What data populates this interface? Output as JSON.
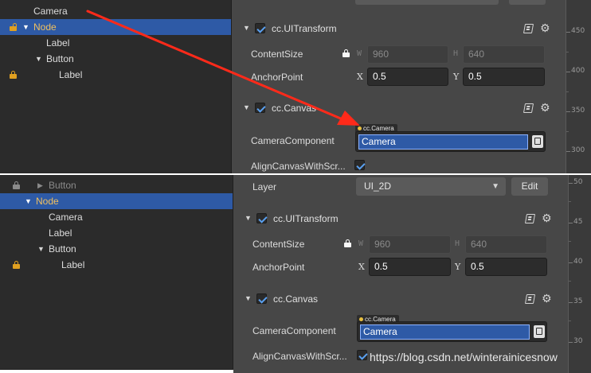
{
  "top": {
    "hierarchy": {
      "items": [
        {
          "label": "Camera"
        },
        {
          "label": "Node"
        },
        {
          "label": "Label"
        },
        {
          "label": "Button"
        },
        {
          "label": "Label"
        }
      ]
    },
    "inspector": {
      "uitransform": {
        "title": "cc.UITransform",
        "content_size_label": "ContentSize",
        "width_axis": "W",
        "width_value": "960",
        "height_axis": "H",
        "height_value": "640",
        "anchor_label": "AnchorPoint",
        "anchor_x_axis": "X",
        "anchor_x_value": "0.5",
        "anchor_y_axis": "Y",
        "anchor_y_value": "0.5"
      },
      "canvas": {
        "title": "cc.Canvas",
        "camera_label": "CameraComponent",
        "camera_tag": "cc.Camera",
        "camera_value": "Camera",
        "align_label": "AlignCanvasWithScr..."
      }
    },
    "ruler": [
      "450",
      "400",
      "350",
      "300"
    ]
  },
  "bottom": {
    "hierarchy": {
      "items": [
        {
          "label": "Button"
        },
        {
          "label": "Node"
        },
        {
          "label": "Camera"
        },
        {
          "label": "Label"
        },
        {
          "label": "Button"
        },
        {
          "label": "Label"
        }
      ]
    },
    "inspector": {
      "layer_label": "Layer",
      "layer_value": "UI_2D",
      "edit_button": "Edit",
      "uitransform": {
        "title": "cc.UITransform",
        "content_size_label": "ContentSize",
        "width_axis": "W",
        "width_value": "960",
        "height_axis": "H",
        "height_value": "640",
        "anchor_label": "AnchorPoint",
        "anchor_x_axis": "X",
        "anchor_x_value": "0.5",
        "anchor_y_axis": "Y",
        "anchor_y_value": "0.5"
      },
      "canvas": {
        "title": "cc.Canvas",
        "camera_label": "CameraComponent",
        "camera_tag": "cc.Camera",
        "camera_value": "Camera",
        "align_label": "AlignCanvasWithScr..."
      }
    },
    "ruler": [
      "50",
      "45",
      "40",
      "35",
      "30"
    ]
  },
  "watermark": "https://blog.csdn.net/winterainicesnow",
  "colors": {
    "hierarchy_bg": "#2b2b2b",
    "inspector_bg": "#474747",
    "selection": "#2e5aa6",
    "annotation_arrow": "#ff2a1a"
  }
}
